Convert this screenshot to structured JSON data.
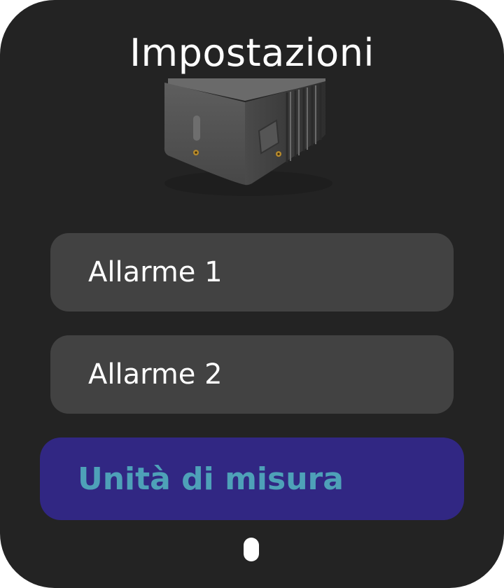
{
  "header": {
    "title": "Impostazioni"
  },
  "device_image": {
    "icon": "sensor-device-image"
  },
  "menu": {
    "items": [
      {
        "label": "Allarme 1",
        "selected": false
      },
      {
        "label": "Allarme 2",
        "selected": false
      },
      {
        "label": "Unità di misura",
        "selected": true
      }
    ]
  },
  "colors": {
    "background": "#232323",
    "item_background": "#424242",
    "selected_background": "#312783",
    "selected_text": "#4ea1b8",
    "text": "#ffffff"
  }
}
